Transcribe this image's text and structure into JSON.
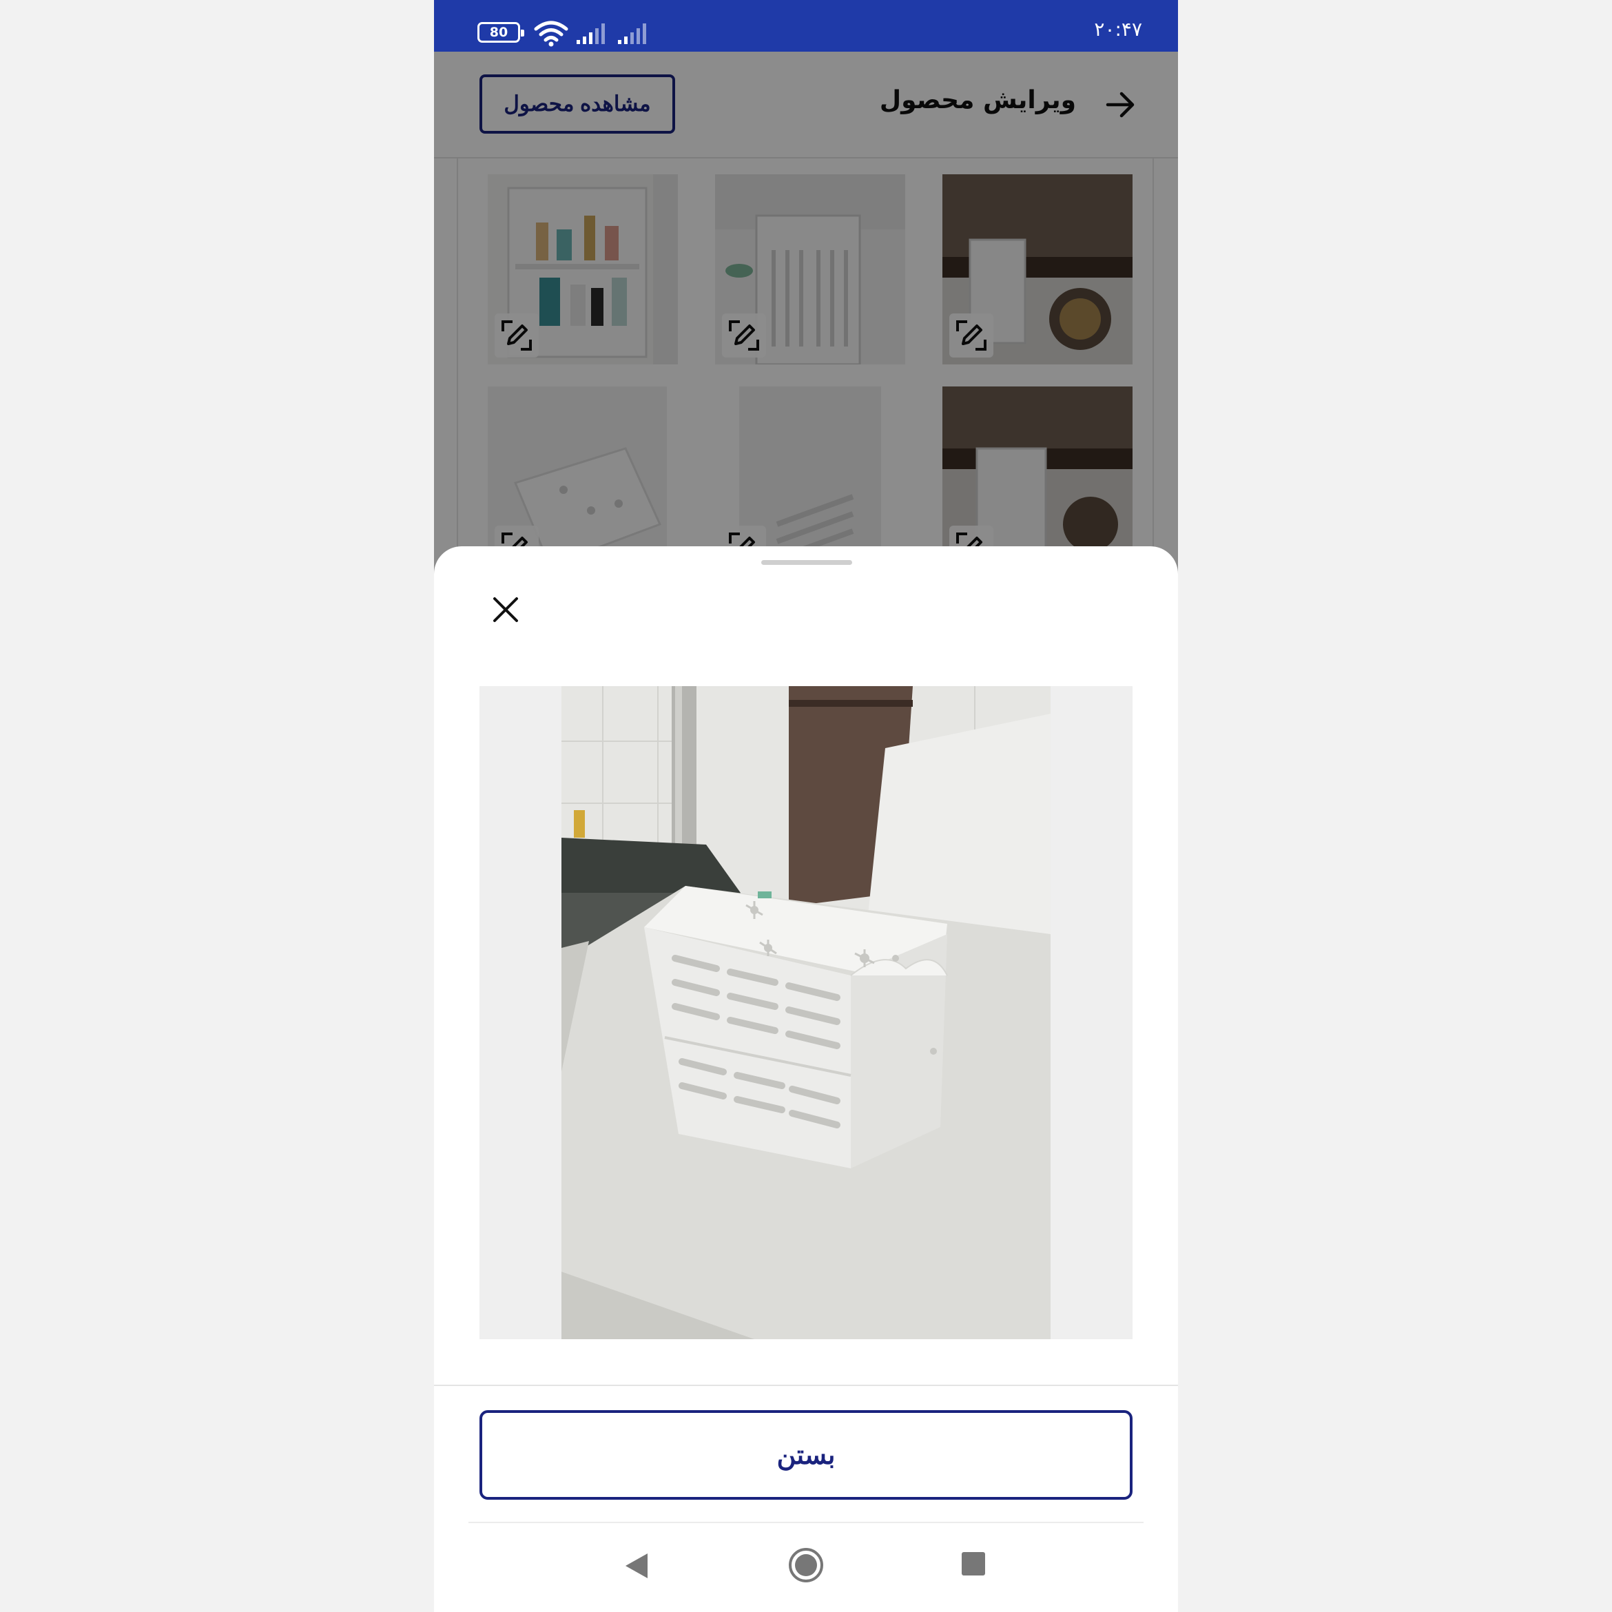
{
  "status_bar": {
    "battery": "80",
    "time": "۲۰:۴۷",
    "icons": [
      "battery-icon",
      "wifi-icon",
      "signal-icon",
      "signal-icon"
    ]
  },
  "header": {
    "title": "ویرایش محصول",
    "view_product_label": "مشاهده محصول",
    "back_icon": "arrow-right-icon"
  },
  "gallery": {
    "edit_icon": "edit-icon"
  },
  "sheet": {
    "close_icon": "close-icon",
    "close_button_label": "بستن"
  },
  "navbar": {
    "icons": [
      "back-triangle-icon",
      "home-circle-icon",
      "recents-square-icon"
    ]
  },
  "colors": {
    "status_bar": "#1f3aa8",
    "primary": "#1a237e"
  }
}
